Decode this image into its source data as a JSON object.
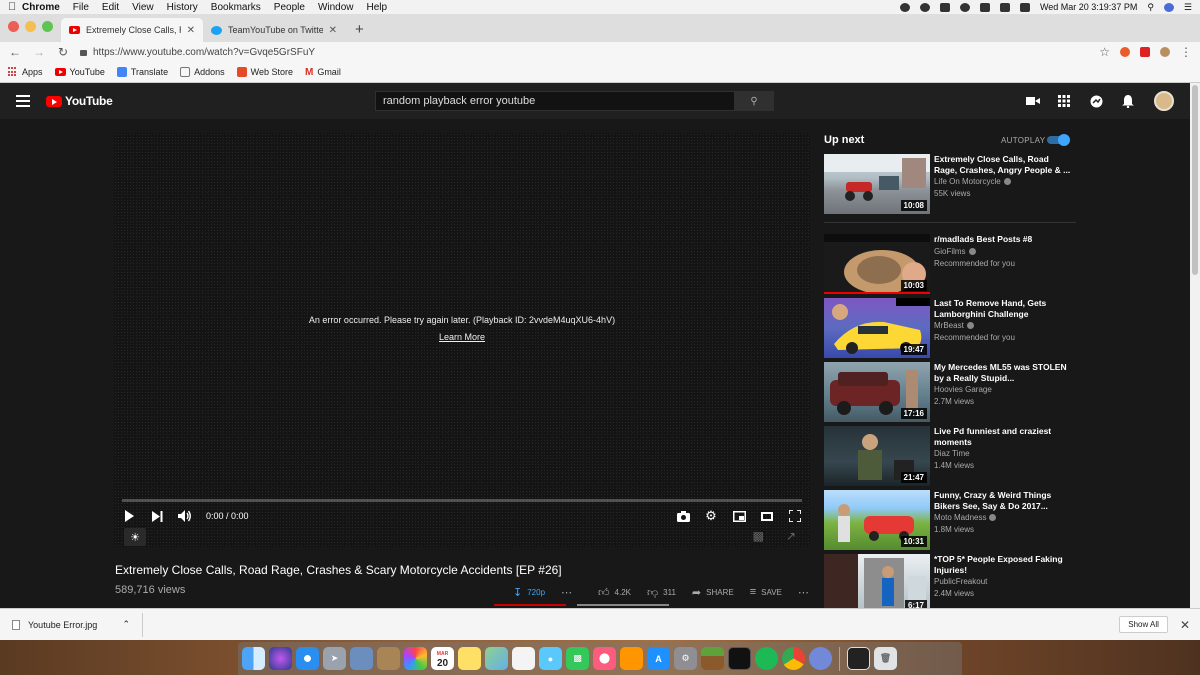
{
  "menubar": {
    "app_name": "Chrome",
    "items": [
      "File",
      "Edit",
      "View",
      "History",
      "Bookmarks",
      "People",
      "Window",
      "Help"
    ],
    "clock": "Wed Mar 20  3:19:37 PM"
  },
  "tabs": [
    {
      "title": "Extremely Close Calls, Road Ra",
      "favicon": "youtube-favicon"
    },
    {
      "title": "TeamYouTube on Twitter: \"We'",
      "favicon": "twitter-favicon"
    }
  ],
  "address": {
    "url": "https://www.youtube.com/watch?v=Gvqe5GrSFuY"
  },
  "bookmarks": [
    "Apps",
    "YouTube",
    "Translate",
    "Addons",
    "Web Store",
    "Gmail"
  ],
  "youtube": {
    "logo": "YouTube",
    "search_value": "random playback error youtube"
  },
  "player": {
    "error": "An error occurred. Please try again later. (Playback ID: 2vvdeM4uqXU6-4hV)",
    "learn_more": "Learn More",
    "time": "0:00 / 0:00"
  },
  "video": {
    "title": "Extremely Close Calls, Road Rage, Crashes & Scary Motorcycle Accidents [EP #26]",
    "views": "589,716 views",
    "quality": "720p",
    "likes": "4.2K",
    "dislikes": "311",
    "share": "SHARE",
    "save": "SAVE"
  },
  "upnext": {
    "label": "Up next",
    "autoplay": "AUTOPLAY",
    "items": [
      {
        "title": "Extremely Close Calls, Road Rage, Crashes, Angry People & ...",
        "channel": "Life On Motorcycle",
        "meta": "55K views",
        "duration": "10:08"
      },
      {
        "title": "r/madlads Best Posts #8",
        "channel": "GioFilms",
        "meta": "Recommended for you",
        "duration": "10:03"
      },
      {
        "title": "Last To Remove Hand, Gets Lamborghini Challenge",
        "channel": "MrBeast",
        "meta": "Recommended for you",
        "duration": "19:47"
      },
      {
        "title": "My Mercedes ML55 was STOLEN by a Really Stupid...",
        "channel": "Hoovies Garage",
        "meta": "2.7M views",
        "duration": "17:16"
      },
      {
        "title": "Live Pd funniest and craziest moments",
        "channel": "Diaz Time",
        "meta": "1.4M views",
        "duration": "21:47"
      },
      {
        "title": "Funny, Crazy & Weird Things Bikers See, Say & Do 2017...",
        "channel": "Moto Madness",
        "meta": "1.8M views",
        "duration": "10:31"
      },
      {
        "title": "*TOP 5* People Exposed Faking Injuries!",
        "channel": "PublicFreakout",
        "meta": "2.4M views",
        "duration": "6:17"
      }
    ]
  },
  "download": {
    "file": "Youtube Error.jpg",
    "show_all": "Show All"
  },
  "dock": {
    "calendar_month": "MAR",
    "calendar_day": "20"
  }
}
